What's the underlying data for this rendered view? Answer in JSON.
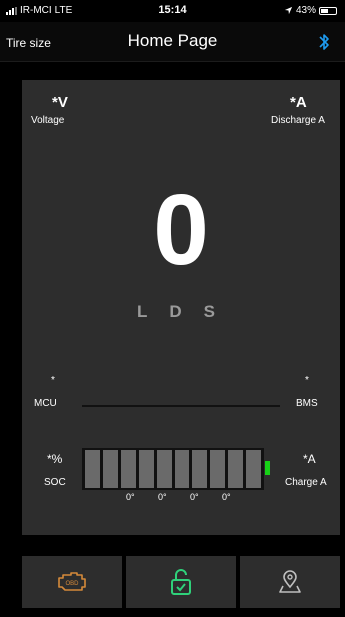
{
  "status": {
    "carrier": "IR-MCI",
    "network": "LTE",
    "time": "15:14",
    "battery": "43%"
  },
  "nav": {
    "left_label": "Tire size",
    "title": "Home Page",
    "bluetooth_icon": "bluetooth-icon"
  },
  "dashboard": {
    "voltage_value": "*V",
    "voltage_label": "Voltage",
    "discharge_value": "*A",
    "discharge_label": "Discharge A",
    "speed": "0",
    "gears": [
      "L",
      "D",
      "S"
    ],
    "mcu_value": "*",
    "mcu_label": "MCU",
    "bms_value": "*",
    "bms_label": "BMS",
    "soc_value": "*%",
    "soc_label": "SOC",
    "charge_value": "*A",
    "charge_label": "Charge A",
    "soc_cells": 10,
    "temps": [
      "0°",
      "0°",
      "0°",
      "0°"
    ]
  },
  "bottom": {
    "items": [
      {
        "icon": "obd-engine-icon",
        "color": "#d58a3a"
      },
      {
        "icon": "unlock-icon",
        "color": "#2fd17a"
      },
      {
        "icon": "map-pin-icon",
        "color": "#bfbfbf"
      }
    ]
  },
  "colors": {
    "panel": "#2d2d2d",
    "bluetooth": "#1e9bf0",
    "soc_tip": "#17d117",
    "gear_inactive": "#9a9a9a"
  }
}
